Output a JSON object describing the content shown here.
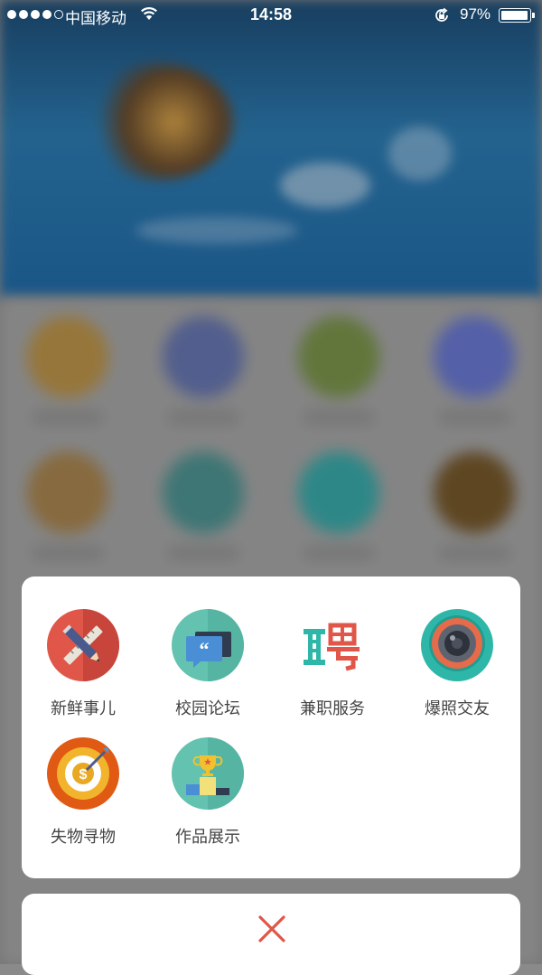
{
  "status_bar": {
    "carrier": "中国移动",
    "time": "14:58",
    "battery_percent_label": "97%",
    "battery_level": 0.97
  },
  "share_menu": {
    "items": [
      {
        "label": "新鲜事儿",
        "icon": "pencil-ruler-icon"
      },
      {
        "label": "校园论坛",
        "icon": "quote-chat-icon"
      },
      {
        "label": "兼职服务",
        "icon": "recruit-pin-icon"
      },
      {
        "label": "爆照交友",
        "icon": "camera-lens-icon"
      },
      {
        "label": "失物寻物",
        "icon": "target-dart-coin-icon"
      },
      {
        "label": "作品展示",
        "icon": "trophy-podium-icon"
      }
    ]
  },
  "cancel": {
    "icon": "close-icon"
  },
  "colors": {
    "red_icon": "#e0574a",
    "teal_icon": "#63c3b0",
    "cancel_x": "#e0574a",
    "label_text": "#444444"
  }
}
